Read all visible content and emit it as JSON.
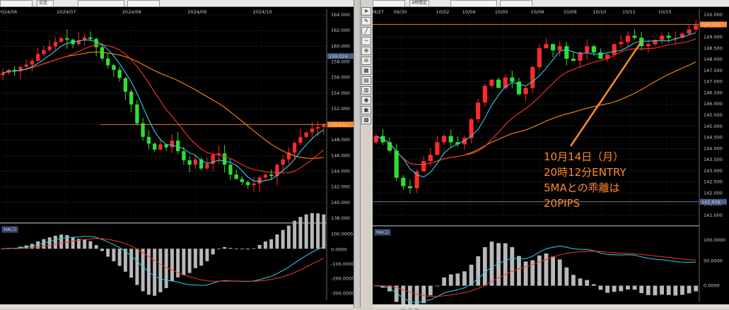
{
  "left_chart": {
    "toolbar": {
      "symbol": "",
      "timeframe": "日足"
    },
    "x_labels": [
      "2024/06",
      "2024/07",
      "2024/08",
      "2024/09",
      "2024/10"
    ],
    "y_ticks": [
      "164.000",
      "162.000",
      "160.000",
      "158.000",
      "156.000",
      "154.000",
      "152.000",
      "150.000",
      "148.000",
      "146.000",
      "144.000",
      "142.000",
      "140.000",
      "138.000"
    ],
    "price_tag": "149.942",
    "high_tag": "159.024",
    "macd_label": "MACD",
    "macd_ticks": [
      "100.0000",
      "0.0000",
      "-100.0000",
      "-200.0000",
      "-300.0000"
    ]
  },
  "right_chart": {
    "toolbar": {
      "symbol": "",
      "timeframe": "4時間足"
    },
    "x_labels": [
      "09/27",
      "09/30",
      "10/02",
      "10/04",
      "10/05",
      "10/08",
      "10/09",
      "10/10",
      "10/11",
      "10/15"
    ],
    "y_ticks": [
      "150.000",
      "149.500",
      "149.000",
      "148.500",
      "148.000",
      "147.500",
      "147.000",
      "146.500",
      "146.000",
      "145.500",
      "145.000",
      "144.500",
      "144.000",
      "143.500",
      "143.000",
      "142.500",
      "142.000",
      "141.500",
      "141.000"
    ],
    "price_tag": "149.942",
    "low_tag": "141.938",
    "macd_label": "MACD",
    "macd_ticks": [
      "100.0000",
      "50.0000",
      "0.0000"
    ],
    "annotation": [
      "10月14日（月）",
      "20時12分ENTRY",
      "5MAとの乖離は",
      "20PIPS"
    ]
  },
  "chart_data": [
    {
      "type": "candlestick",
      "timeframe": "daily",
      "x": [
        "2024/06",
        "2024/07",
        "2024/08",
        "2024/09",
        "2024/10"
      ],
      "ylim": [
        137.5,
        164.5
      ],
      "close": [
        156.8,
        157.2,
        157.0,
        157.6,
        157.9,
        158.4,
        159.3,
        159.8,
        160.3,
        160.9,
        161.4,
        161.2,
        160.6,
        161.1,
        161.5,
        161.3,
        160.2,
        158.7,
        157.8,
        157.2,
        156.1,
        154.3,
        152.6,
        150.1,
        148.3,
        147.4,
        146.6,
        147.3,
        146.9,
        147.8,
        146.4,
        145.2,
        144.6,
        145.3,
        144.1,
        144.7,
        145.9,
        146.1,
        144.6,
        143.3,
        142.7,
        142.3,
        141.9,
        142.1,
        142.9,
        143.3,
        143.1,
        144.6,
        145.3,
        146.2,
        147.5,
        148.3,
        148.9,
        149.4,
        149.6,
        149.9
      ],
      "series": [
        {
          "name": "5MA",
          "color": "#2fd0e8"
        },
        {
          "name": "20MA",
          "color": "#ff3030"
        },
        {
          "name": "75MA",
          "color": "#ff8c00"
        }
      ],
      "hline": 149.94
    },
    {
      "type": "candlestick",
      "timeframe": "4H",
      "x": [
        "09/27",
        "09/30",
        "10/02",
        "10/04",
        "10/05",
        "10/08",
        "10/09",
        "10/10",
        "10/11",
        "10/15"
      ],
      "ylim": [
        140.8,
        150.4
      ],
      "close": [
        144.6,
        144.3,
        143.9,
        142.6,
        142.2,
        142.1,
        142.9,
        143.4,
        143.7,
        144.3,
        144.6,
        144.3,
        144.2,
        144.5,
        145.4,
        146.2,
        147.0,
        147.3,
        146.9,
        147.4,
        147.2,
        146.6,
        146.9,
        147.9,
        148.8,
        149.0,
        148.7,
        148.9,
        148.3,
        148.2,
        148.6,
        148.9,
        148.6,
        148.3,
        148.5,
        149.0,
        149.1,
        149.4,
        149.3,
        148.9,
        149.0,
        149.2,
        149.4,
        149.3,
        149.3,
        149.5,
        149.7,
        149.9
      ],
      "series": [
        {
          "name": "5MA",
          "color": "#2fd0e8"
        },
        {
          "name": "20MA",
          "color": "#ff3030"
        },
        {
          "name": "75MA",
          "color": "#ff8c00"
        }
      ],
      "hline": 149.94
    }
  ]
}
